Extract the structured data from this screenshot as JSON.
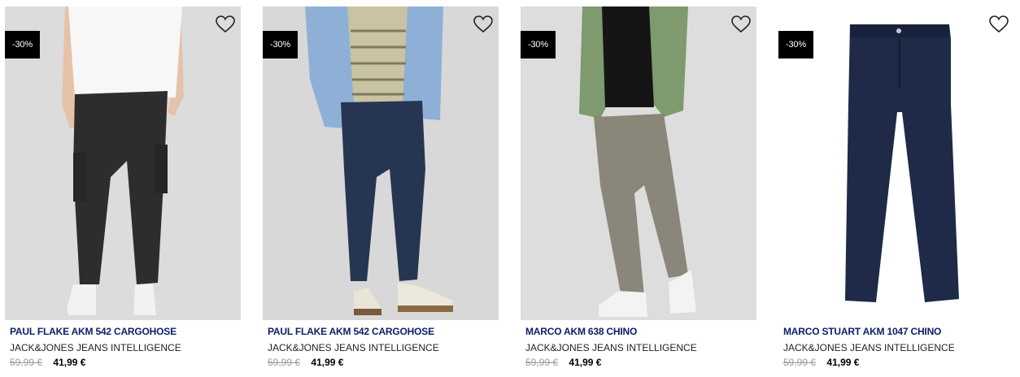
{
  "products": [
    {
      "badge": "-30%",
      "name": "PAUL FLAKE AKM 542 CARGOHOSE",
      "brand": "JACK&JONES JEANS INTELLIGENCE",
      "old_price": "59,99 €",
      "new_price": "41,99 €"
    },
    {
      "badge": "-30%",
      "name": "PAUL FLAKE AKM 542 CARGOHOSE",
      "brand": "JACK&JONES JEANS INTELLIGENCE",
      "old_price": "59,99 €",
      "new_price": "41,99 €"
    },
    {
      "badge": "-30%",
      "name": "MARCO AKM 638 CHINO",
      "brand": "JACK&JONES JEANS INTELLIGENCE",
      "old_price": "59,99 €",
      "new_price": "41,99 €"
    },
    {
      "badge": "-30%",
      "name": "MARCO STUART AKM 1047 CHINO",
      "brand": "JACK&JONES JEANS INTELLIGENCE",
      "old_price": "59,99 €",
      "new_price": "41,99 €"
    }
  ],
  "icons": {
    "wishlist": "heart-outline-icon"
  },
  "colors": {
    "name": "#0b1f63",
    "badge_bg": "#000000",
    "old_price": "#9a9a9a"
  }
}
